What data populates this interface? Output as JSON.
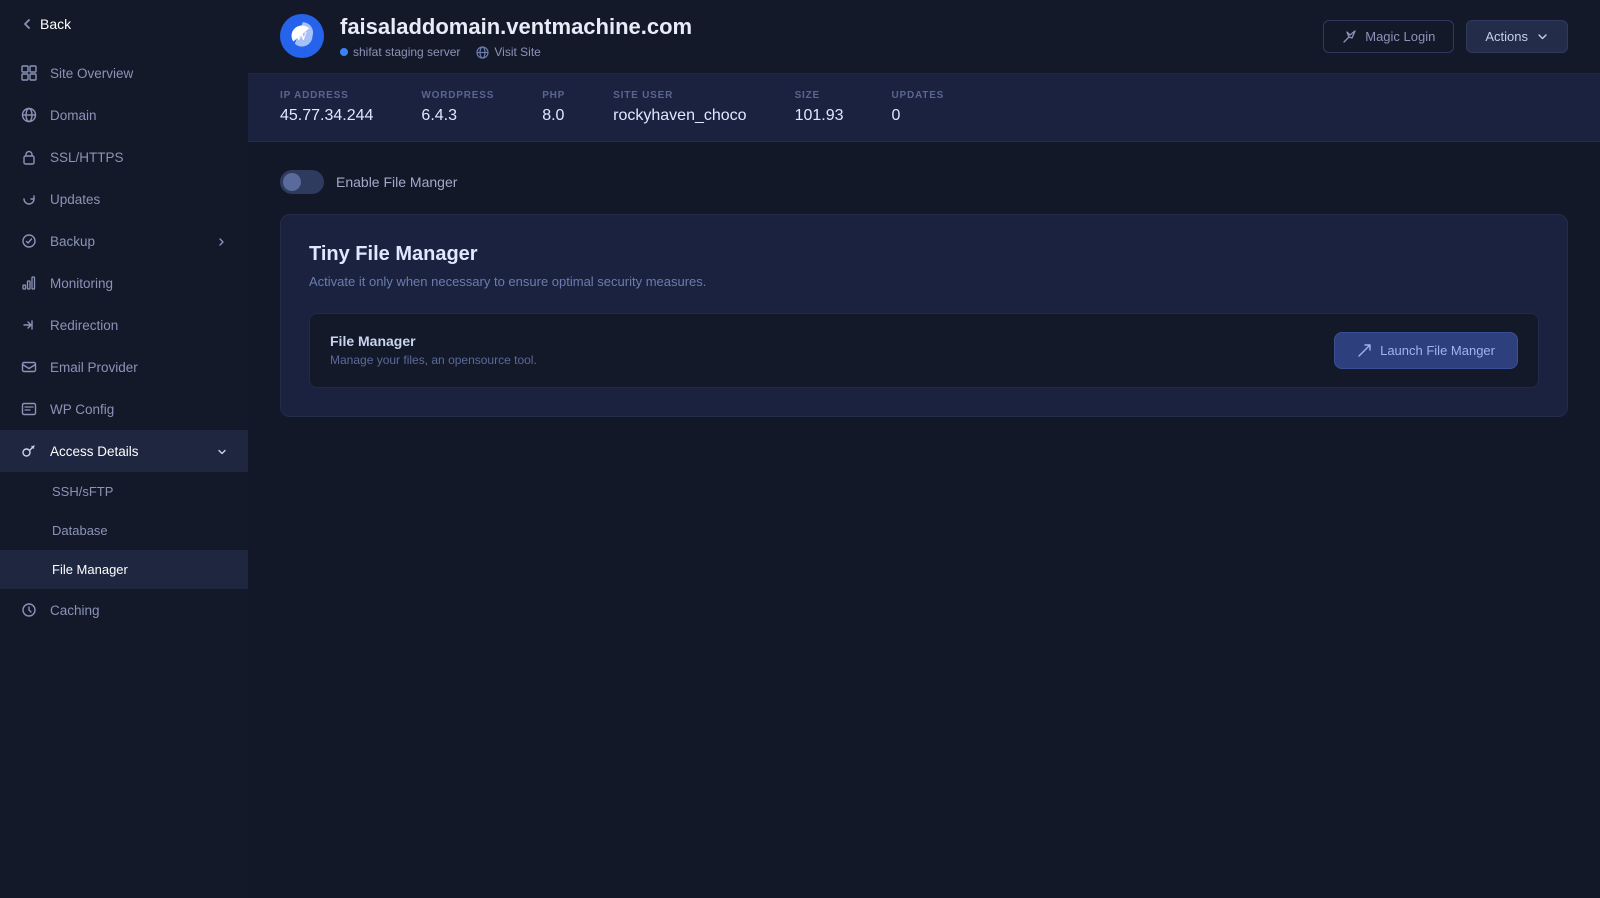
{
  "sidebar": {
    "back_label": "Back",
    "items": [
      {
        "id": "site-overview",
        "label": "Site Overview",
        "icon": "grid"
      },
      {
        "id": "domain",
        "label": "Domain",
        "icon": "globe"
      },
      {
        "id": "ssl-https",
        "label": "SSL/HTTPS",
        "icon": "lock"
      },
      {
        "id": "updates",
        "label": "Updates",
        "icon": "refresh"
      },
      {
        "id": "backup",
        "label": "Backup",
        "icon": "archive",
        "has_chevron": true
      },
      {
        "id": "monitoring",
        "label": "Monitoring",
        "icon": "chart"
      },
      {
        "id": "redirection",
        "label": "Redirection",
        "icon": "redirect"
      },
      {
        "id": "email-provider",
        "label": "Email Provider",
        "icon": "email"
      },
      {
        "id": "wp-config",
        "label": "WP Config",
        "icon": "config"
      },
      {
        "id": "access-details",
        "label": "Access Details",
        "icon": "key",
        "active": true,
        "has_chevron": true,
        "expanded": true
      },
      {
        "id": "caching",
        "label": "Caching",
        "icon": "cache"
      }
    ],
    "submenu": [
      {
        "id": "ssh-sftp",
        "label": "SSH/sFTP"
      },
      {
        "id": "database",
        "label": "Database"
      },
      {
        "id": "file-manager",
        "label": "File Manager",
        "active": true
      }
    ]
  },
  "header": {
    "site_name": "faisaladdomain.ventmachine.com",
    "server_tag": "shifat staging server",
    "visit_site_label": "Visit Site",
    "magic_login_label": "Magic Login",
    "actions_label": "Actions"
  },
  "stats": [
    {
      "label": "IP ADDRESS",
      "value": "45.77.34.244"
    },
    {
      "label": "WORDPRESS",
      "value": "6.4.3"
    },
    {
      "label": "PHP",
      "value": "8.0"
    },
    {
      "label": "SITE USER",
      "value": "rockyhaven_choco"
    },
    {
      "label": "SIZE",
      "value": "101.93"
    },
    {
      "label": "UPDATES",
      "value": "0"
    }
  ],
  "content": {
    "toggle_label": "Enable File Manger",
    "toggle_on": false,
    "card_title": "Tiny File Manager",
    "card_desc": "Activate it only when necessary to ensure optimal security measures.",
    "file_manager": {
      "title": "File Manager",
      "desc": "Manage your files, an opensource tool.",
      "launch_label": "Launch File Manger"
    }
  },
  "colors": {
    "accent": "#2563eb",
    "active_bg": "#1e2640",
    "sidebar_bg": "#141929"
  }
}
